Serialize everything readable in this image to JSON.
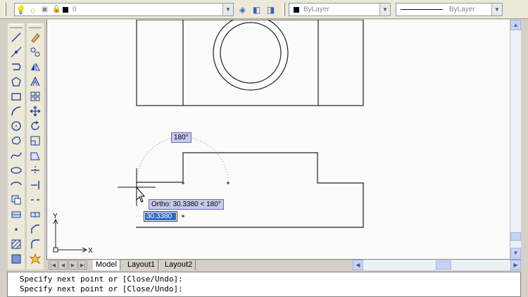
{
  "toolbar": {
    "layer_value": "0",
    "color_value": "ByLayer",
    "linetype_value": "ByLayer"
  },
  "drawing": {
    "angle_tooltip": "180°",
    "ortho_tooltip": "Ortho: 30.3380 < 180°",
    "length_input": "30.3380"
  },
  "ucs": {
    "y_label": "Y",
    "x_label": "X"
  },
  "tabs": [
    {
      "label": "Model",
      "active": true
    },
    {
      "label": "Layout1",
      "active": false
    },
    {
      "label": "Layout2",
      "active": false
    }
  ],
  "command_line": [
    "Specify next point or [Close/Undo]:",
    "Specify next point or [Close/Undo]:"
  ],
  "colors": {
    "canvas": "#fbfbf9",
    "tooltip_bg": "#c8c8ee",
    "selection": "#316ac5",
    "tool_blue": "#1a3c9c"
  },
  "icons": {
    "left_palette": [
      "line-icon",
      "construction-line-icon",
      "polyline-icon",
      "polygon-icon",
      "rectangle-icon",
      "arc-icon",
      "circle-icon",
      "revision-cloud-icon",
      "spline-icon",
      "ellipse-icon",
      "ellipse-arc-icon",
      "insert-block-icon",
      "make-block-icon",
      "point-icon",
      "hatch-icon",
      "gradient-icon"
    ],
    "right_palette": [
      "erase-icon",
      "copy-icon",
      "mirror-icon",
      "offset-icon",
      "array-icon",
      "move-icon",
      "rotate-icon",
      "scale-icon",
      "stretch-icon",
      "trim-icon",
      "extend-icon",
      "break-icon",
      "join-icon",
      "chamfer-icon",
      "fillet-icon",
      "explode-icon"
    ]
  }
}
